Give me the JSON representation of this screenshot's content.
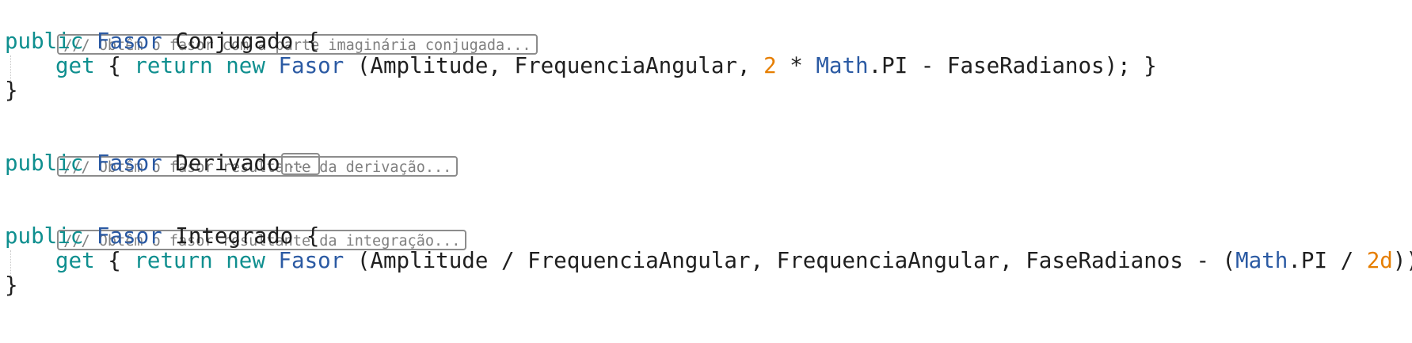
{
  "editor": {
    "blocks": [
      {
        "summary": "/// Obtêm o fasor com a parte imaginária conjugada...",
        "header": {
          "mod": "public",
          "type": "Fasor",
          "name": "Conjugado",
          "brace": " {"
        },
        "body": {
          "get": "get",
          "open": " { ",
          "ret": "return",
          "new": "new",
          "type": "Fasor",
          "args_a": " (Amplitude, FrequenciaAngular, ",
          "num": "2",
          "args_b": " * ",
          "math": "Math",
          "args_c": ".PI - FaseRadianos); }"
        },
        "close": "}"
      },
      {
        "summary": "/// Obtêm o fasor resultante da derivação...",
        "header": {
          "mod": "public",
          "type": "Fasor",
          "name": "Derivado",
          "collapsed": "..."
        }
      },
      {
        "summary": "/// Obtêm o fasor resultante da integração...",
        "header": {
          "mod": "public",
          "type": "Fasor",
          "name": "Integrado",
          "brace": " {"
        },
        "body": {
          "get": "get",
          "open": " { ",
          "ret": "return",
          "new": "new",
          "type": "Fasor",
          "args_a": " (Amplitude / FrequenciaAngular, FrequenciaAngular, FaseRadianos - (",
          "math": "Math",
          "args_b": ".PI / ",
          "num": "2d",
          "args_c": ")); }"
        },
        "close": "}"
      }
    ]
  }
}
